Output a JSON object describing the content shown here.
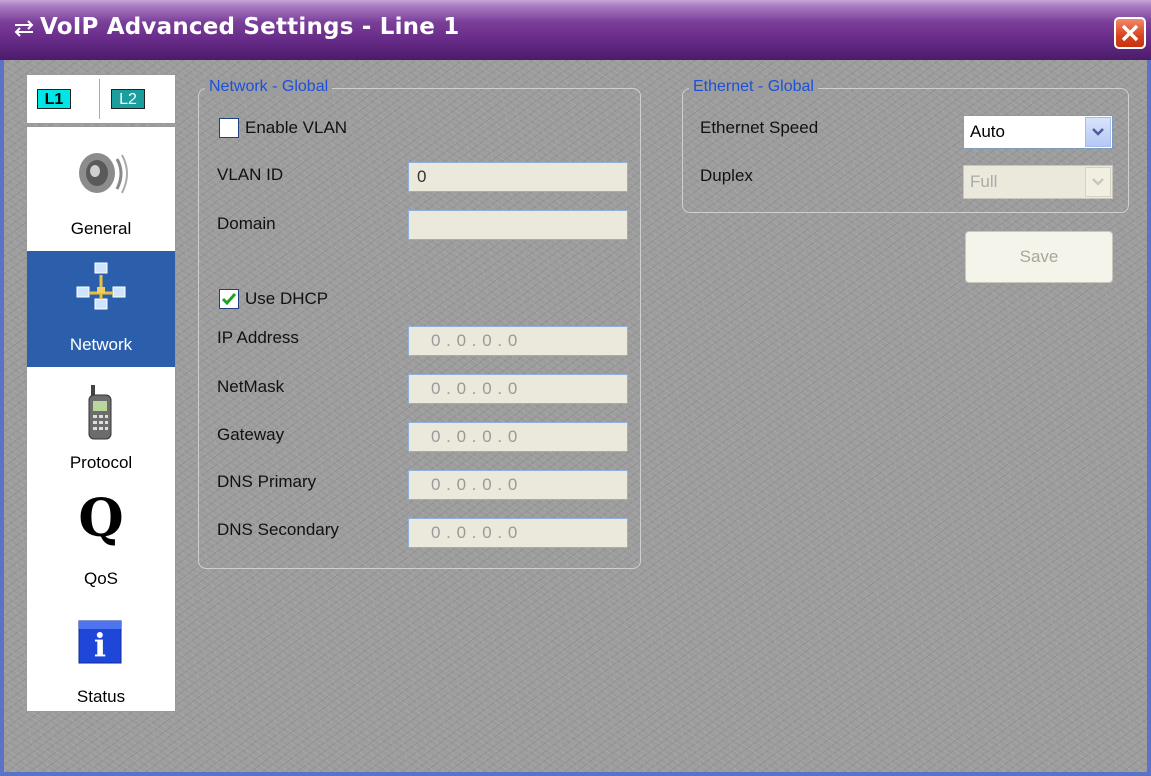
{
  "window": {
    "title": "VoIP Advanced Settings - Line 1"
  },
  "line_tabs": [
    "L1",
    "L2"
  ],
  "sidebar": {
    "items": [
      {
        "label": "General",
        "icon": "speaker-icon"
      },
      {
        "label": "Network",
        "icon": "network-icon",
        "selected": true
      },
      {
        "label": "Protocol",
        "icon": "phone-icon"
      },
      {
        "label": "QoS",
        "icon": "qos-icon"
      },
      {
        "label": "Status",
        "icon": "info-icon"
      }
    ]
  },
  "network_global": {
    "title": "Network - Global",
    "enable_vlan_label": "Enable VLAN",
    "enable_vlan_checked": false,
    "vlan_id_label": "VLAN ID",
    "vlan_id_value": "0",
    "domain_label": "Domain",
    "domain_value": "",
    "use_dhcp_label": "Use DHCP",
    "use_dhcp_checked": true,
    "ip_address_label": "IP Address",
    "ip_address_value": "0 . 0 . 0 . 0",
    "netmask_label": "NetMask",
    "netmask_value": "0 . 0 . 0 . 0",
    "gateway_label": "Gateway",
    "gateway_value": "0 . 0 . 0 . 0",
    "dns_primary_label": "DNS Primary",
    "dns_primary_value": "0 . 0 . 0 . 0",
    "dns_secondary_label": "DNS Secondary",
    "dns_secondary_value": "0 . 0 . 0 . 0"
  },
  "ethernet_global": {
    "title": "Ethernet - Global",
    "speed_label": "Ethernet Speed",
    "speed_value": "Auto",
    "duplex_label": "Duplex",
    "duplex_value": "Full"
  },
  "save_label": "Save",
  "colors": {
    "title_bar": "#672b88",
    "group_title": "#1d50d8",
    "selected_item": "#2c5fab",
    "l1_tab": "#00e5e5",
    "l2_tab": "#1a9e9e"
  }
}
